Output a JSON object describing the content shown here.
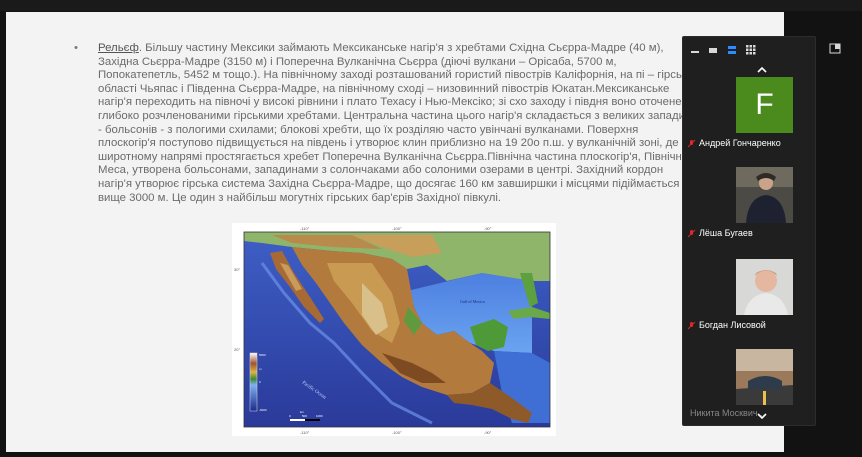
{
  "slide": {
    "lead": "Рельєф",
    "body": ". Більшу частину Мексики займають Мексиканське нагір'я з хребтами Східна Сьєрра-Мадре (40 м), Західна Сьєрра-Мадре (3150 м) і Поперечна Вулканічна Сьєрра (діючі вулкани – Орісаба, 5700 м, Попокатепетль, 5452 м тощо.). На північному заході розташований гористий півострів Каліфорнія, на пі – гірські області Чьяпас і Південна Сьєрра-Мадре, на північному сході – низовинний півострів Юкатан.Мексиканське нагір'я переходить на півночі у високі рівнини і плато Техасу і Нью-Мексіко; зі схо заходу і півдня воно оточене глибоко розчленованими гірськими хребтами. Центральна частина цього нагір'я складається з великих западин - больсонів - з пологими схилами; блокові хребти, що їх розділяю часто увінчані вулканами. Поверхня плоскогір'я поступово підвищується на південь і утворює клин приблизно на 19 20о п.ш. у вулканічній зоні, де в широтному напрямі простягається хребет Поперечна Вулканічна Сьєрра.Північна частина плоскогір'я, Північна Меса, утворена больсонами, западинами з солончаками або солоними озерами в центрі. Західний кордон нагір'я утворює гірська система Західна Сьєрра-Мадре, що досягає 160 км завширшки і місцями підіймається вище 3000 м. Це один з найбільш могутніх гірських бар'єрів Західної півкулі."
  },
  "map": {
    "top_ticks": [
      "-110°",
      "-100°",
      "-90°"
    ],
    "bottom_ticks": [
      "-110°",
      "-100°",
      "-90°"
    ],
    "left_ticks": [
      "30°",
      "20°"
    ],
    "legend_labels": [
      "5000",
      "4000",
      "3000",
      "2000",
      "1000",
      "0",
      "-1000",
      "-2000",
      "-3000",
      "-4000",
      "-5000",
      "-6000"
    ],
    "legend_unit": "m",
    "scale_labels": [
      "0",
      "500",
      "1000"
    ],
    "scale_unit": "km",
    "ocean_label": "Pacific Ocean",
    "gulf_label": "Gulf of Mexico"
  },
  "panel": {
    "participants": [
      {
        "name": "Андрей Гончаренко",
        "avatar_letter": "F",
        "avatar_color": "#4b8b1e"
      },
      {
        "name": "Лёша Бугаев"
      },
      {
        "name": "Богдан Лисовой"
      },
      {
        "name": "Никита Москвич..."
      }
    ]
  },
  "colors": {
    "panel_bg": "#1f1f1f",
    "accent_blue": "#2d8cff",
    "mute_red": "#e02828"
  }
}
